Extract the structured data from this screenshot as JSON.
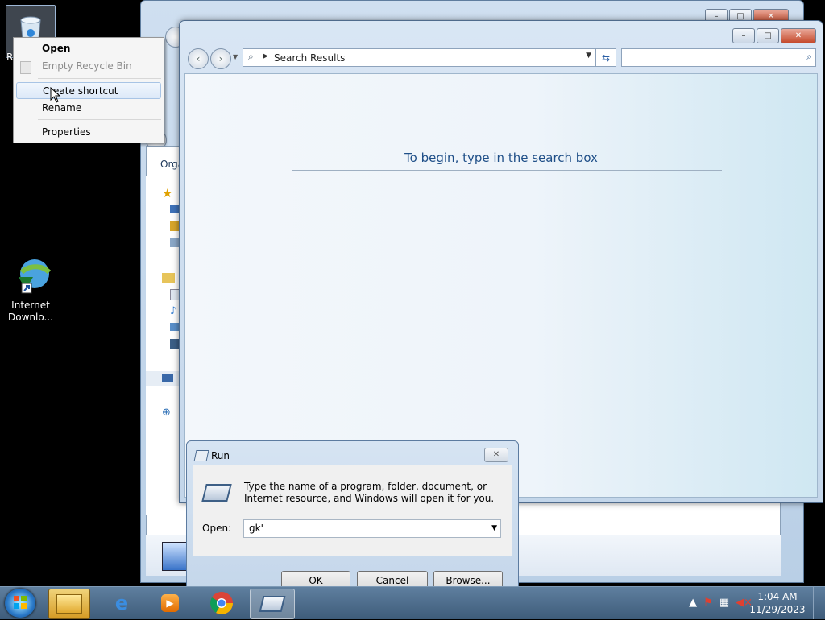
{
  "desktop": {
    "icons": [
      {
        "label": "Recycle Bin",
        "visible_label": "R"
      },
      {
        "label_line1": "Internet",
        "label_line2": "Downlo..."
      }
    ]
  },
  "explorer_back": {
    "toolbar_label": "Orga"
  },
  "search_window": {
    "address_text": "Search Results",
    "search_placeholder": "",
    "hint": "To begin, type in the search box"
  },
  "context_menu": {
    "items": [
      {
        "label": "Open"
      },
      {
        "label": "Empty Recycle Bin"
      },
      {
        "label": "Create shortcut"
      },
      {
        "label": "Rename"
      },
      {
        "label": "Properties"
      }
    ]
  },
  "run_dialog": {
    "title": "Run",
    "message": "Type the name of a program, folder, document, or Internet resource, and Windows will open it for you.",
    "open_label": "Open:",
    "open_value": "gk'",
    "ok_label": "OK",
    "cancel_label": "Cancel",
    "browse_label": "Browse..."
  },
  "taskbar": {
    "pinned": [
      "start-orb",
      "explorer-icon",
      "ie-icon",
      "media-player-icon",
      "chrome-icon",
      "run-icon"
    ],
    "clock_time": "1:04 AM",
    "clock_date": "11/29/2023"
  }
}
